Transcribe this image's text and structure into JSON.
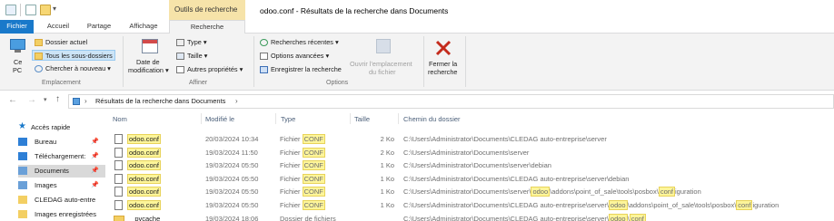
{
  "titlebar": {
    "context_tab": "Outils de recherche",
    "window_title": "odoo.conf - Résultats de la recherche dans Documents"
  },
  "tabs": [
    "Fichier",
    "Accueil",
    "Partage",
    "Affichage",
    "Recherche"
  ],
  "ribbon": {
    "location": {
      "this_pc_line1": "Ce",
      "this_pc_line2": "PC",
      "current_folder": "Dossier actuel",
      "all_subfolders": "Tous les sous-dossiers",
      "search_again": "Chercher à nouveau ▾",
      "group_label": "Emplacement"
    },
    "refine": {
      "date_line1": "Date de",
      "date_line2": "modification ▾",
      "type": "Type ▾",
      "size": "Taille ▾",
      "other_props": "Autres propriétés ▾",
      "group_label": "Affiner"
    },
    "options": {
      "recent_searches": "Recherches récentes ▾",
      "advanced_options": "Options avancées ▾",
      "save_search": "Enregistrer la recherche",
      "open_location_line1": "Ouvrir l'emplacement",
      "open_location_line2": "du fichier",
      "group_label": "Options"
    },
    "close": {
      "line1": "Fermer la",
      "line2": "recherche"
    }
  },
  "address": {
    "breadcrumb": "Résultats de la recherche dans Documents",
    "separator": "›"
  },
  "nav": {
    "quick_access": "Accès rapide",
    "items": [
      {
        "label": "Bureau",
        "pinned": true
      },
      {
        "label": "Téléchargement:",
        "pinned": true
      },
      {
        "label": "Documents",
        "pinned": true,
        "selected": true
      },
      {
        "label": "Images",
        "pinned": true
      },
      {
        "label": "CLEDAG auto-entre",
        "pinned": false
      },
      {
        "label": "Images enregistrées",
        "pinned": false
      }
    ]
  },
  "columns": [
    "Nom",
    "Modifié le",
    "Type",
    "Taille",
    "Chemin du dossier"
  ],
  "rows": [
    {
      "name": "odoo.conf",
      "modified": "20/03/2024 10:34",
      "type_prefix": "Fichier ",
      "type_hl": "CONF",
      "size": "2 Ko",
      "path": [
        {
          "t": "C:\\Users\\Administrator\\Documents\\CLEDAG auto-entreprise\\server"
        }
      ]
    },
    {
      "name": "odoo.conf",
      "modified": "19/03/2024 11:50",
      "type_prefix": "Fichier ",
      "type_hl": "CONF",
      "size": "2 Ko",
      "path": [
        {
          "t": "C:\\Users\\Administrator\\Documents\\server"
        }
      ]
    },
    {
      "name": "odoo.conf",
      "modified": "19/03/2024 05:50",
      "type_prefix": "Fichier ",
      "type_hl": "CONF",
      "size": "1 Ko",
      "path": [
        {
          "t": "C:\\Users\\Administrator\\Documents\\server\\debian"
        }
      ]
    },
    {
      "name": "odoo.conf",
      "modified": "19/03/2024 05:50",
      "type_prefix": "Fichier ",
      "type_hl": "CONF",
      "size": "1 Ko",
      "path": [
        {
          "t": "C:\\Users\\Administrator\\Documents\\CLEDAG auto-entreprise\\server\\debian"
        }
      ]
    },
    {
      "name": "odoo.conf",
      "modified": "19/03/2024 05:50",
      "type_prefix": "Fichier ",
      "type_hl": "CONF",
      "size": "1 Ko",
      "path": [
        {
          "t": "C:\\Users\\Administrator\\Documents\\server\\"
        },
        {
          "h": "odoo"
        },
        {
          "t": "\\addons\\point_of_sale\\tools\\posbox\\"
        },
        {
          "h": "conf"
        },
        {
          "t": "iguration"
        }
      ]
    },
    {
      "name": "odoo.conf",
      "modified": "19/03/2024 05:50",
      "type_prefix": "Fichier ",
      "type_hl": "CONF",
      "size": "1 Ko",
      "path": [
        {
          "t": "C:\\Users\\Administrator\\Documents\\CLEDAG auto-entreprise\\server\\"
        },
        {
          "h": "odoo"
        },
        {
          "t": "\\addons\\point_of_sale\\tools\\posbox\\"
        },
        {
          "h": "conf"
        },
        {
          "t": "iguration"
        }
      ]
    },
    {
      "name": "__pycache__",
      "folder": true,
      "modified": "19/03/2024 18:06",
      "type_prefix": "Dossier de fichiers",
      "type_hl": "",
      "size": "",
      "path": [
        {
          "t": "C:\\Users\\Administrator\\Documents\\CLEDAG auto-entreprise\\server\\"
        },
        {
          "h": "odoo"
        },
        {
          "t": "\\"
        },
        {
          "h": "conf"
        }
      ]
    }
  ],
  "colors": {
    "accent": "#1979ca",
    "context_tab": "#f6e3a9",
    "highlight": "#fdf59a",
    "selection": "#cce4f7"
  }
}
